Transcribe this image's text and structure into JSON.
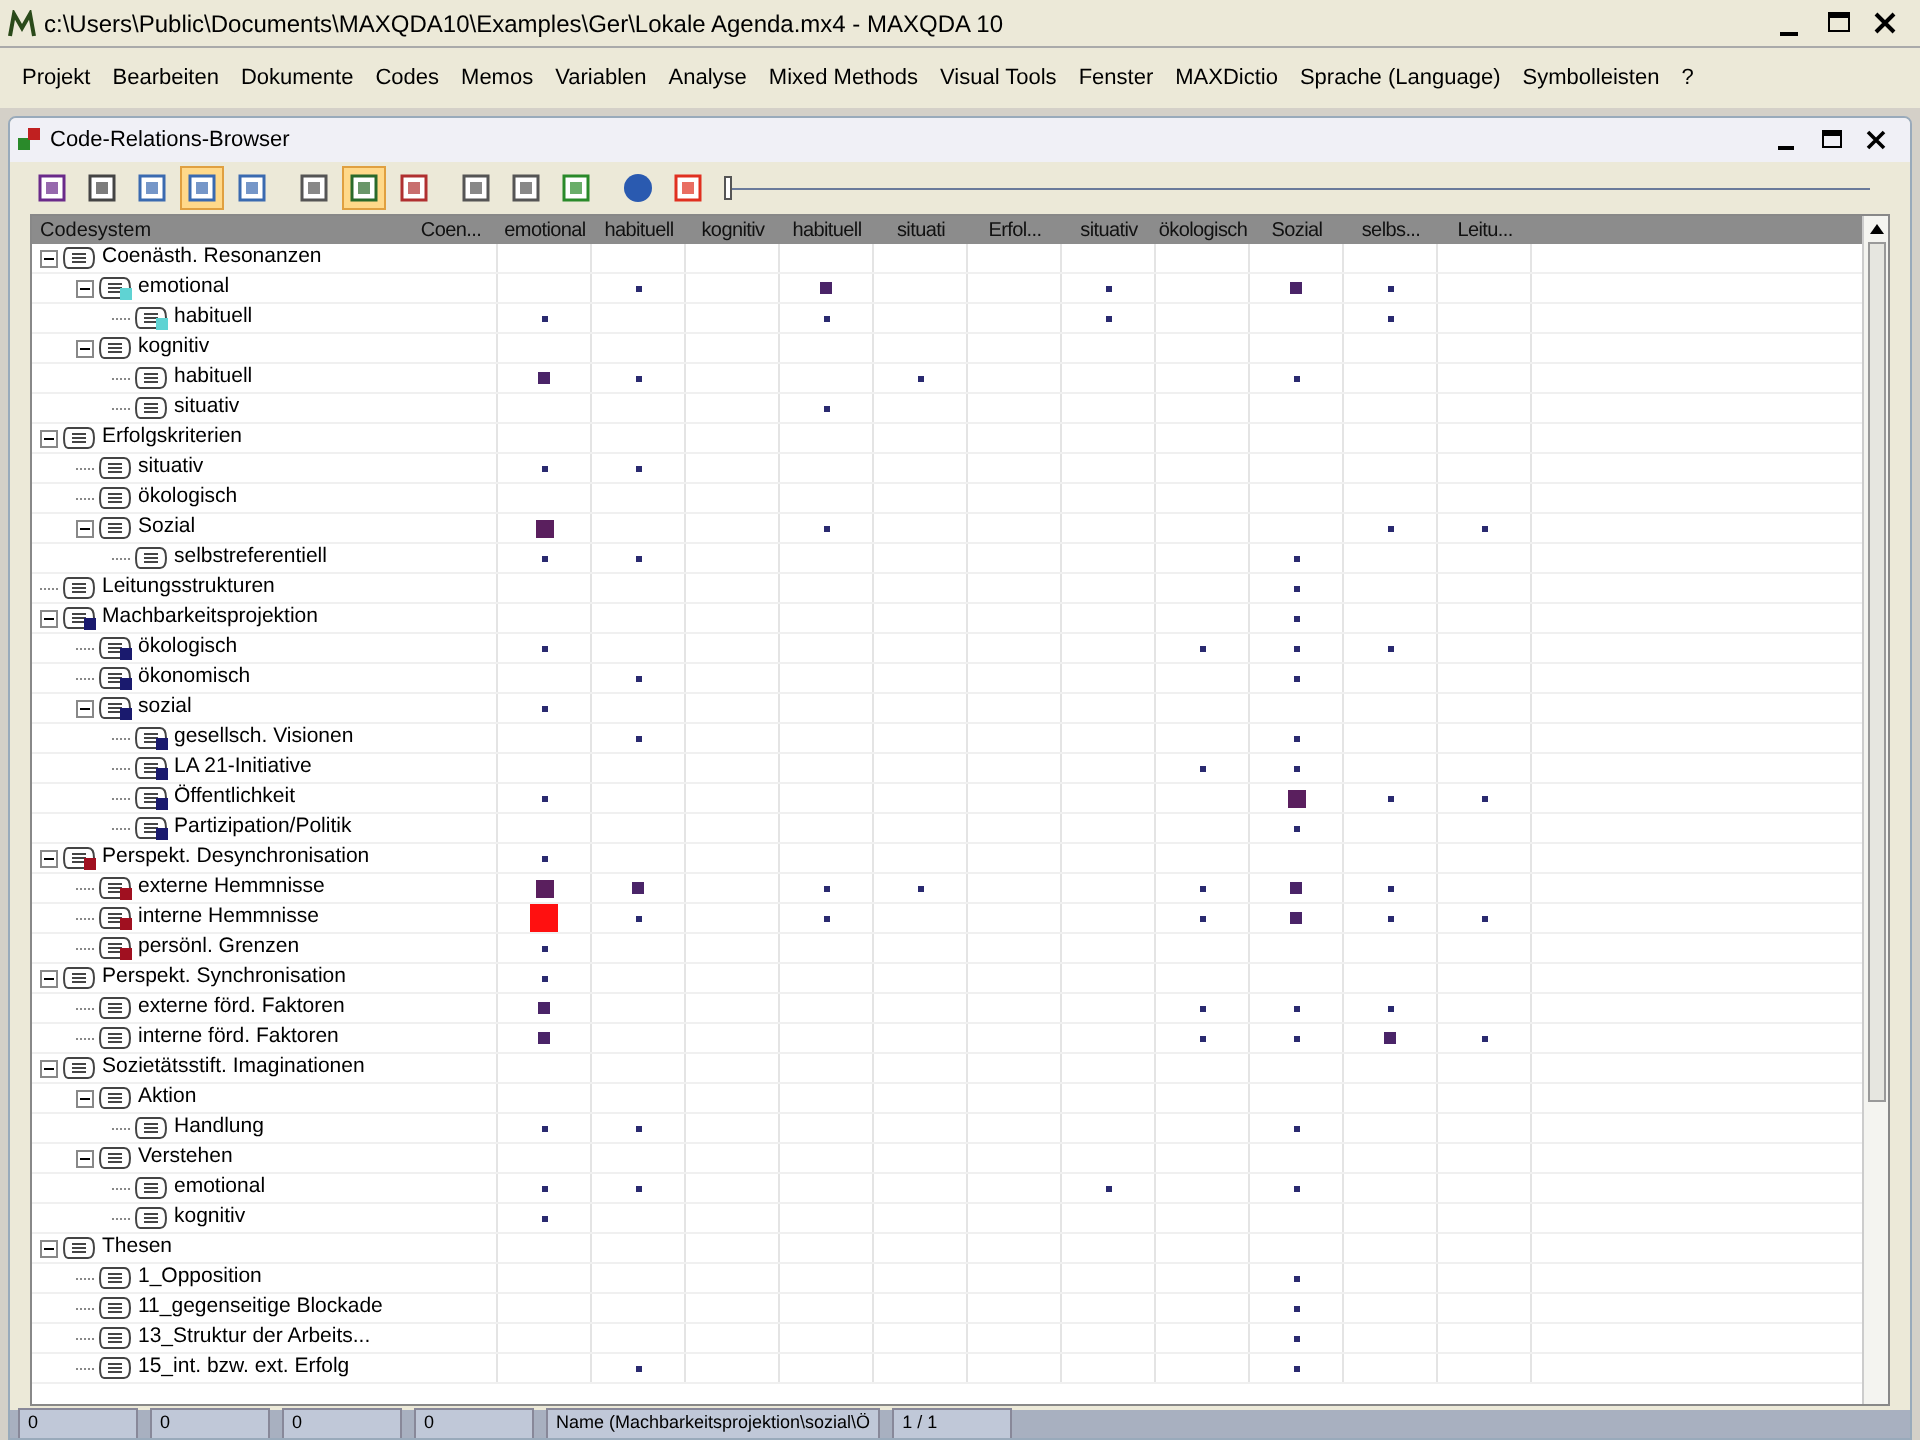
{
  "window": {
    "title": "c:\\Users\\Public\\Documents\\MAXQDA10\\Examples\\Ger\\Lokale Agenda.mx4 - MAXQDA 10"
  },
  "menu": [
    "Projekt",
    "Bearbeiten",
    "Dokumente",
    "Codes",
    "Memos",
    "Variablen",
    "Analyse",
    "Mixed Methods",
    "Visual Tools",
    "Fenster",
    "MAXDictio",
    "Sprache (Language)",
    "Symbolleisten",
    "?"
  ],
  "browser": {
    "title": "Code-Relations-Browser",
    "toolbar": [
      {
        "selected": false
      },
      {
        "selected": false
      },
      {
        "selected": false
      },
      {
        "selected": true
      },
      {
        "selected": false
      },
      {
        "selected": false
      },
      {
        "selected": true
      },
      {
        "selected": false
      },
      {
        "selected": false
      },
      {
        "selected": false
      },
      {
        "selected": false
      },
      {
        "selected": false
      },
      {
        "selected": false
      }
    ],
    "slider": {
      "level": 0
    },
    "header": "Codesystem",
    "columns": [
      "Coen...",
      "emotional",
      "habituell",
      "kognitiv",
      "habituell",
      "situati",
      "Erfol...",
      "situativ",
      "ökologisch",
      "Sozial",
      "selbs...",
      "Leitu..."
    ],
    "codes": [
      {
        "name": "Coenästh. Resonanzen",
        "expanded": true,
        "cells": [
          {
            "kind": "none"
          },
          {
            "kind": "none"
          },
          {
            "kind": "none"
          },
          {
            "kind": "none"
          },
          {
            "kind": "none"
          },
          {
            "kind": "none"
          },
          {
            "kind": "none"
          },
          {
            "kind": "none"
          },
          {
            "kind": "none"
          },
          {
            "kind": "none"
          },
          {
            "kind": "none"
          },
          {
            "kind": "none"
          }
        ],
        "children": [
          {
            "name": "emotional",
            "expanded": true,
            "color": "#5fd3d3",
            "cells": [
              {
                "kind": "none"
              },
              {
                "kind": "none"
              },
              {
                "kind": "small"
              },
              {
                "kind": "none"
              },
              {
                "kind": "medium"
              },
              {
                "kind": "none"
              },
              {
                "kind": "none"
              },
              {
                "kind": "small"
              },
              {
                "kind": "none"
              },
              {
                "kind": "medium"
              },
              {
                "kind": "small"
              },
              {
                "kind": "none"
              }
            ],
            "children": [
              {
                "name": "habituell",
                "color": "#5fd3d3",
                "cells": [
                  {
                    "kind": "none"
                  },
                  {
                    "kind": "small"
                  },
                  {
                    "kind": "none"
                  },
                  {
                    "kind": "none"
                  },
                  {
                    "kind": "small"
                  },
                  {
                    "kind": "none"
                  },
                  {
                    "kind": "none"
                  },
                  {
                    "kind": "small"
                  },
                  {
                    "kind": "none"
                  },
                  {
                    "kind": "none"
                  },
                  {
                    "kind": "small"
                  },
                  {
                    "kind": "none"
                  }
                ]
              }
            ]
          },
          {
            "name": "kognitiv",
            "expanded": true,
            "cells": [
              {
                "kind": "none"
              },
              {
                "kind": "none"
              },
              {
                "kind": "none"
              },
              {
                "kind": "none"
              },
              {
                "kind": "none"
              },
              {
                "kind": "none"
              },
              {
                "kind": "none"
              },
              {
                "kind": "none"
              },
              {
                "kind": "none"
              },
              {
                "kind": "none"
              },
              {
                "kind": "none"
              },
              {
                "kind": "none"
              }
            ],
            "children": [
              {
                "name": "habituell",
                "cells": [
                  {
                    "kind": "none"
                  },
                  {
                    "kind": "medium"
                  },
                  {
                    "kind": "small"
                  },
                  {
                    "kind": "none"
                  },
                  {
                    "kind": "none"
                  },
                  {
                    "kind": "small"
                  },
                  {
                    "kind": "none"
                  },
                  {
                    "kind": "none"
                  },
                  {
                    "kind": "none"
                  },
                  {
                    "kind": "small"
                  },
                  {
                    "kind": "none"
                  },
                  {
                    "kind": "none"
                  }
                ]
              },
              {
                "name": "situativ",
                "cells": [
                  {
                    "kind": "none"
                  },
                  {
                    "kind": "none"
                  },
                  {
                    "kind": "none"
                  },
                  {
                    "kind": "none"
                  },
                  {
                    "kind": "small"
                  },
                  {
                    "kind": "none"
                  },
                  {
                    "kind": "none"
                  },
                  {
                    "kind": "none"
                  },
                  {
                    "kind": "none"
                  },
                  {
                    "kind": "none"
                  },
                  {
                    "kind": "none"
                  },
                  {
                    "kind": "none"
                  }
                ]
              }
            ]
          }
        ]
      },
      {
        "name": "Erfolgskriterien",
        "expanded": true,
        "cells": [
          {
            "kind": "none"
          },
          {
            "kind": "none"
          },
          {
            "kind": "none"
          },
          {
            "kind": "none"
          },
          {
            "kind": "none"
          },
          {
            "kind": "none"
          },
          {
            "kind": "none"
          },
          {
            "kind": "none"
          },
          {
            "kind": "none"
          },
          {
            "kind": "none"
          },
          {
            "kind": "none"
          },
          {
            "kind": "none"
          }
        ],
        "children": [
          {
            "name": "situativ",
            "cells": [
              {
                "kind": "none"
              },
              {
                "kind": "small"
              },
              {
                "kind": "small"
              },
              {
                "kind": "none"
              },
              {
                "kind": "none"
              },
              {
                "kind": "none"
              },
              {
                "kind": "none"
              },
              {
                "kind": "none"
              },
              {
                "kind": "none"
              },
              {
                "kind": "none"
              },
              {
                "kind": "none"
              },
              {
                "kind": "none"
              }
            ]
          },
          {
            "name": "ökologisch",
            "cells": [
              {
                "kind": "none"
              },
              {
                "kind": "none"
              },
              {
                "kind": "none"
              },
              {
                "kind": "none"
              },
              {
                "kind": "none"
              },
              {
                "kind": "none"
              },
              {
                "kind": "none"
              },
              {
                "kind": "none"
              },
              {
                "kind": "none"
              },
              {
                "kind": "none"
              },
              {
                "kind": "none"
              },
              {
                "kind": "none"
              }
            ]
          },
          {
            "name": "Sozial",
            "expanded": true,
            "cells": [
              {
                "kind": "none"
              },
              {
                "kind": "large"
              },
              {
                "kind": "none"
              },
              {
                "kind": "none"
              },
              {
                "kind": "small"
              },
              {
                "kind": "none"
              },
              {
                "kind": "none"
              },
              {
                "kind": "none"
              },
              {
                "kind": "none"
              },
              {
                "kind": "none"
              },
              {
                "kind": "small"
              },
              {
                "kind": "small"
              }
            ],
            "children": [
              {
                "name": "selbstreferentiell",
                "cells": [
                  {
                    "kind": "none"
                  },
                  {
                    "kind": "small"
                  },
                  {
                    "kind": "small"
                  },
                  {
                    "kind": "none"
                  },
                  {
                    "kind": "none"
                  },
                  {
                    "kind": "none"
                  },
                  {
                    "kind": "none"
                  },
                  {
                    "kind": "none"
                  },
                  {
                    "kind": "none"
                  },
                  {
                    "kind": "small"
                  },
                  {
                    "kind": "none"
                  },
                  {
                    "kind": "none"
                  }
                ]
              }
            ]
          }
        ]
      },
      {
        "name": "Leitungsstrukturen",
        "cells": [
          {
            "kind": "none"
          },
          {
            "kind": "none"
          },
          {
            "kind": "none"
          },
          {
            "kind": "none"
          },
          {
            "kind": "none"
          },
          {
            "kind": "none"
          },
          {
            "kind": "none"
          },
          {
            "kind": "none"
          },
          {
            "kind": "none"
          },
          {
            "kind": "small"
          },
          {
            "kind": "none"
          },
          {
            "kind": "none"
          }
        ]
      },
      {
        "name": "Machbarkeitsprojektion",
        "expanded": true,
        "color": "#1a1a6e",
        "cells": [
          {
            "kind": "none"
          },
          {
            "kind": "none"
          },
          {
            "kind": "none"
          },
          {
            "kind": "none"
          },
          {
            "kind": "none"
          },
          {
            "kind": "none"
          },
          {
            "kind": "none"
          },
          {
            "kind": "none"
          },
          {
            "kind": "none"
          },
          {
            "kind": "small"
          },
          {
            "kind": "none"
          },
          {
            "kind": "none"
          }
        ],
        "children": [
          {
            "name": "ökologisch",
            "color": "#1a1a6e",
            "cells": [
              {
                "kind": "none"
              },
              {
                "kind": "small"
              },
              {
                "kind": "none"
              },
              {
                "kind": "none"
              },
              {
                "kind": "none"
              },
              {
                "kind": "none"
              },
              {
                "kind": "none"
              },
              {
                "kind": "none"
              },
              {
                "kind": "small"
              },
              {
                "kind": "small"
              },
              {
                "kind": "small"
              },
              {
                "kind": "none"
              }
            ]
          },
          {
            "name": "ökonomisch",
            "color": "#1a1a6e",
            "cells": [
              {
                "kind": "none"
              },
              {
                "kind": "none"
              },
              {
                "kind": "small"
              },
              {
                "kind": "none"
              },
              {
                "kind": "none"
              },
              {
                "kind": "none"
              },
              {
                "kind": "none"
              },
              {
                "kind": "none"
              },
              {
                "kind": "none"
              },
              {
                "kind": "small"
              },
              {
                "kind": "none"
              },
              {
                "kind": "none"
              }
            ]
          },
          {
            "name": "sozial",
            "expanded": true,
            "color": "#1a1a6e",
            "cells": [
              {
                "kind": "none"
              },
              {
                "kind": "small"
              },
              {
                "kind": "none"
              },
              {
                "kind": "none"
              },
              {
                "kind": "none"
              },
              {
                "kind": "none"
              },
              {
                "kind": "none"
              },
              {
                "kind": "none"
              },
              {
                "kind": "none"
              },
              {
                "kind": "none"
              },
              {
                "kind": "none"
              },
              {
                "kind": "none"
              }
            ],
            "children": [
              {
                "name": "gesellsch. Visionen",
                "color": "#1a1a6e",
                "cells": [
                  {
                    "kind": "none"
                  },
                  {
                    "kind": "none"
                  },
                  {
                    "kind": "small"
                  },
                  {
                    "kind": "none"
                  },
                  {
                    "kind": "none"
                  },
                  {
                    "kind": "none"
                  },
                  {
                    "kind": "none"
                  },
                  {
                    "kind": "none"
                  },
                  {
                    "kind": "none"
                  },
                  {
                    "kind": "small"
                  },
                  {
                    "kind": "none"
                  },
                  {
                    "kind": "none"
                  }
                ]
              },
              {
                "name": "LA 21-Initiative",
                "color": "#1a1a6e",
                "cells": [
                  {
                    "kind": "none"
                  },
                  {
                    "kind": "none"
                  },
                  {
                    "kind": "none"
                  },
                  {
                    "kind": "none"
                  },
                  {
                    "kind": "none"
                  },
                  {
                    "kind": "none"
                  },
                  {
                    "kind": "none"
                  },
                  {
                    "kind": "none"
                  },
                  {
                    "kind": "small"
                  },
                  {
                    "kind": "small"
                  },
                  {
                    "kind": "none"
                  },
                  {
                    "kind": "none"
                  }
                ]
              },
              {
                "name": "Öffentlichkeit",
                "color": "#1a1a6e",
                "cells": [
                  {
                    "kind": "none"
                  },
                  {
                    "kind": "small"
                  },
                  {
                    "kind": "none"
                  },
                  {
                    "kind": "none"
                  },
                  {
                    "kind": "none"
                  },
                  {
                    "kind": "none"
                  },
                  {
                    "kind": "none"
                  },
                  {
                    "kind": "none"
                  },
                  {
                    "kind": "none"
                  },
                  {
                    "kind": "large"
                  },
                  {
                    "kind": "small"
                  },
                  {
                    "kind": "small"
                  }
                ]
              },
              {
                "name": "Partizipation/Politik",
                "color": "#1a1a6e",
                "cells": [
                  {
                    "kind": "none"
                  },
                  {
                    "kind": "none"
                  },
                  {
                    "kind": "none"
                  },
                  {
                    "kind": "none"
                  },
                  {
                    "kind": "none"
                  },
                  {
                    "kind": "none"
                  },
                  {
                    "kind": "none"
                  },
                  {
                    "kind": "none"
                  },
                  {
                    "kind": "none"
                  },
                  {
                    "kind": "small"
                  },
                  {
                    "kind": "none"
                  },
                  {
                    "kind": "none"
                  }
                ]
              }
            ]
          }
        ]
      },
      {
        "name": "Perspekt. Desynchronisation",
        "expanded": true,
        "color": "#a01020",
        "cells": [
          {
            "kind": "none"
          },
          {
            "kind": "small"
          },
          {
            "kind": "none"
          },
          {
            "kind": "none"
          },
          {
            "kind": "none"
          },
          {
            "kind": "none"
          },
          {
            "kind": "none"
          },
          {
            "kind": "none"
          },
          {
            "kind": "none"
          },
          {
            "kind": "none"
          },
          {
            "kind": "none"
          },
          {
            "kind": "none"
          }
        ],
        "children": [
          {
            "name": "externe Hemmnisse",
            "color": "#a01020",
            "cells": [
              {
                "kind": "none"
              },
              {
                "kind": "large"
              },
              {
                "kind": "medium"
              },
              {
                "kind": "none"
              },
              {
                "kind": "small"
              },
              {
                "kind": "small"
              },
              {
                "kind": "none"
              },
              {
                "kind": "none"
              },
              {
                "kind": "small"
              },
              {
                "kind": "medium"
              },
              {
                "kind": "small"
              },
              {
                "kind": "none"
              }
            ]
          },
          {
            "name": "interne Hemmnisse",
            "color": "#a01020",
            "cells": [
              {
                "kind": "none"
              },
              {
                "kind": "max"
              },
              {
                "kind": "small"
              },
              {
                "kind": "none"
              },
              {
                "kind": "small"
              },
              {
                "kind": "none"
              },
              {
                "kind": "none"
              },
              {
                "kind": "none"
              },
              {
                "kind": "small"
              },
              {
                "kind": "medium"
              },
              {
                "kind": "small"
              },
              {
                "kind": "small"
              }
            ]
          },
          {
            "name": "persönl. Grenzen",
            "color": "#a01020",
            "cells": [
              {
                "kind": "none"
              },
              {
                "kind": "small"
              },
              {
                "kind": "none"
              },
              {
                "kind": "none"
              },
              {
                "kind": "none"
              },
              {
                "kind": "none"
              },
              {
                "kind": "none"
              },
              {
                "kind": "none"
              },
              {
                "kind": "none"
              },
              {
                "kind": "none"
              },
              {
                "kind": "none"
              },
              {
                "kind": "none"
              }
            ]
          }
        ]
      },
      {
        "name": "Perspekt. Synchronisation",
        "expanded": true,
        "cells": [
          {
            "kind": "none"
          },
          {
            "kind": "small"
          },
          {
            "kind": "none"
          },
          {
            "kind": "none"
          },
          {
            "kind": "none"
          },
          {
            "kind": "none"
          },
          {
            "kind": "none"
          },
          {
            "kind": "none"
          },
          {
            "kind": "none"
          },
          {
            "kind": "none"
          },
          {
            "kind": "none"
          },
          {
            "kind": "none"
          }
        ],
        "children": [
          {
            "name": "externe förd. Faktoren",
            "cells": [
              {
                "kind": "none"
              },
              {
                "kind": "medium"
              },
              {
                "kind": "none"
              },
              {
                "kind": "none"
              },
              {
                "kind": "none"
              },
              {
                "kind": "none"
              },
              {
                "kind": "none"
              },
              {
                "kind": "none"
              },
              {
                "kind": "small"
              },
              {
                "kind": "small"
              },
              {
                "kind": "small"
              },
              {
                "kind": "none"
              }
            ]
          },
          {
            "name": "interne förd. Faktoren",
            "cells": [
              {
                "kind": "none"
              },
              {
                "kind": "medium"
              },
              {
                "kind": "none"
              },
              {
                "kind": "none"
              },
              {
                "kind": "none"
              },
              {
                "kind": "none"
              },
              {
                "kind": "none"
              },
              {
                "kind": "none"
              },
              {
                "kind": "small"
              },
              {
                "kind": "small"
              },
              {
                "kind": "medium"
              },
              {
                "kind": "small"
              }
            ]
          }
        ]
      },
      {
        "name": "Sozietätsstift. Imaginationen",
        "expanded": true,
        "cells": [
          {
            "kind": "none"
          },
          {
            "kind": "none"
          },
          {
            "kind": "none"
          },
          {
            "kind": "none"
          },
          {
            "kind": "none"
          },
          {
            "kind": "none"
          },
          {
            "kind": "none"
          },
          {
            "kind": "none"
          },
          {
            "kind": "none"
          },
          {
            "kind": "none"
          },
          {
            "kind": "none"
          },
          {
            "kind": "none"
          }
        ],
        "children": [
          {
            "name": "Aktion",
            "expanded": true,
            "cells": [
              {
                "kind": "none"
              },
              {
                "kind": "none"
              },
              {
                "kind": "none"
              },
              {
                "kind": "none"
              },
              {
                "kind": "none"
              },
              {
                "kind": "none"
              },
              {
                "kind": "none"
              },
              {
                "kind": "none"
              },
              {
                "kind": "none"
              },
              {
                "kind": "none"
              },
              {
                "kind": "none"
              },
              {
                "kind": "none"
              }
            ],
            "children": [
              {
                "name": "Handlung",
                "cells": [
                  {
                    "kind": "none"
                  },
                  {
                    "kind": "small"
                  },
                  {
                    "kind": "small"
                  },
                  {
                    "kind": "none"
                  },
                  {
                    "kind": "none"
                  },
                  {
                    "kind": "none"
                  },
                  {
                    "kind": "none"
                  },
                  {
                    "kind": "none"
                  },
                  {
                    "kind": "none"
                  },
                  {
                    "kind": "small"
                  },
                  {
                    "kind": "none"
                  },
                  {
                    "kind": "none"
                  }
                ]
              }
            ]
          },
          {
            "name": "Verstehen",
            "expanded": true,
            "cells": [
              {
                "kind": "none"
              },
              {
                "kind": "none"
              },
              {
                "kind": "none"
              },
              {
                "kind": "none"
              },
              {
                "kind": "none"
              },
              {
                "kind": "none"
              },
              {
                "kind": "none"
              },
              {
                "kind": "none"
              },
              {
                "kind": "none"
              },
              {
                "kind": "none"
              },
              {
                "kind": "none"
              },
              {
                "kind": "none"
              }
            ],
            "children": [
              {
                "name": "emotional",
                "cells": [
                  {
                    "kind": "none"
                  },
                  {
                    "kind": "small"
                  },
                  {
                    "kind": "small"
                  },
                  {
                    "kind": "none"
                  },
                  {
                    "kind": "none"
                  },
                  {
                    "kind": "none"
                  },
                  {
                    "kind": "none"
                  },
                  {
                    "kind": "small"
                  },
                  {
                    "kind": "none"
                  },
                  {
                    "kind": "small"
                  },
                  {
                    "kind": "none"
                  },
                  {
                    "kind": "none"
                  }
                ]
              },
              {
                "name": "kognitiv",
                "cells": [
                  {
                    "kind": "none"
                  },
                  {
                    "kind": "small"
                  },
                  {
                    "kind": "none"
                  },
                  {
                    "kind": "none"
                  },
                  {
                    "kind": "none"
                  },
                  {
                    "kind": "none"
                  },
                  {
                    "kind": "none"
                  },
                  {
                    "kind": "none"
                  },
                  {
                    "kind": "none"
                  },
                  {
                    "kind": "none"
                  },
                  {
                    "kind": "none"
                  },
                  {
                    "kind": "none"
                  }
                ]
              }
            ]
          }
        ]
      },
      {
        "name": "Thesen",
        "expanded": true,
        "cells": [
          {
            "kind": "none"
          },
          {
            "kind": "none"
          },
          {
            "kind": "none"
          },
          {
            "kind": "none"
          },
          {
            "kind": "none"
          },
          {
            "kind": "none"
          },
          {
            "kind": "none"
          },
          {
            "kind": "none"
          },
          {
            "kind": "none"
          },
          {
            "kind": "none"
          },
          {
            "kind": "none"
          },
          {
            "kind": "none"
          }
        ],
        "children": [
          {
            "name": "1_Opposition",
            "cells": [
              {
                "kind": "none"
              },
              {
                "kind": "none"
              },
              {
                "kind": "none"
              },
              {
                "kind": "none"
              },
              {
                "kind": "none"
              },
              {
                "kind": "none"
              },
              {
                "kind": "none"
              },
              {
                "kind": "none"
              },
              {
                "kind": "none"
              },
              {
                "kind": "small"
              },
              {
                "kind": "none"
              },
              {
                "kind": "none"
              }
            ]
          },
          {
            "name": "11_gegenseitige Blockade",
            "cells": [
              {
                "kind": "none"
              },
              {
                "kind": "none"
              },
              {
                "kind": "none"
              },
              {
                "kind": "none"
              },
              {
                "kind": "none"
              },
              {
                "kind": "none"
              },
              {
                "kind": "none"
              },
              {
                "kind": "none"
              },
              {
                "kind": "none"
              },
              {
                "kind": "small"
              },
              {
                "kind": "none"
              },
              {
                "kind": "none"
              }
            ]
          },
          {
            "name": "13_Struktur der Arbeits...",
            "cells": [
              {
                "kind": "none"
              },
              {
                "kind": "none"
              },
              {
                "kind": "none"
              },
              {
                "kind": "none"
              },
              {
                "kind": "none"
              },
              {
                "kind": "none"
              },
              {
                "kind": "none"
              },
              {
                "kind": "none"
              },
              {
                "kind": "none"
              },
              {
                "kind": "small"
              },
              {
                "kind": "none"
              },
              {
                "kind": "none"
              }
            ]
          },
          {
            "name": "15_int. bzw. ext. Erfolg",
            "cells": [
              {
                "kind": "none"
              },
              {
                "kind": "none"
              },
              {
                "kind": "small"
              },
              {
                "kind": "none"
              },
              {
                "kind": "none"
              },
              {
                "kind": "none"
              },
              {
                "kind": "none"
              },
              {
                "kind": "none"
              },
              {
                "kind": "none"
              },
              {
                "kind": "small"
              },
              {
                "kind": "none"
              },
              {
                "kind": "none"
              }
            ]
          }
        ]
      }
    ]
  },
  "status_bar": [
    "0",
    "0",
    "0",
    "0",
    "Name (Machbarkeitsprojektion\\sozial\\Ö",
    "1 / 1"
  ]
}
